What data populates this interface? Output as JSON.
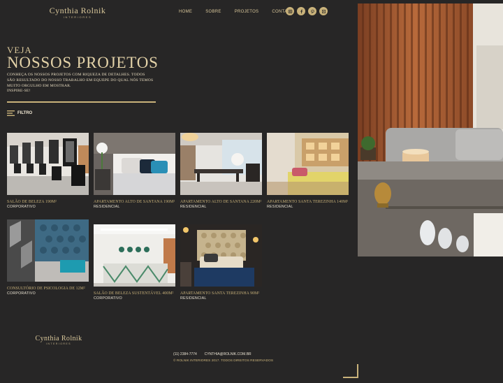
{
  "header": {
    "logo_name": "Cynthia Rolnik",
    "logo_sub": "INTERIORES",
    "nav": [
      "HOME",
      "SOBRE",
      "PROJETOS",
      "CONTATO"
    ],
    "social_icons": [
      "instagram-icon",
      "facebook-icon",
      "pinterest-icon",
      "houzz-icon"
    ]
  },
  "hero": {
    "kicker": "VEJA",
    "title": "NOSSOS PROJETOS",
    "description": "Conheça os nossos projetos com riqueza de detalhes. Todos são resultado do nosso trabalho em equepe do qual nós temos muito orgulho em mostrar.",
    "cta": "Inspire-se!",
    "filter_label": "FILTRO"
  },
  "projects": [
    {
      "title": "SALÃO DE BELEZA 190M²",
      "category": "CORPORATIVO"
    },
    {
      "title": "APARTAMENTO ALTO DE SANTANA 190M²",
      "category": "RESIDENCIAL"
    },
    {
      "title": "APARTAMENTO ALTO DE SANTANA 220M²",
      "category": "RESIDENCIAL"
    },
    {
      "title": "APARTAMENTO SANTA TEREZINHA 140M²",
      "category": "RESIDENCIAL"
    },
    {
      "title": "CONSULTÓRIO DE PSICOLOGIA DE 12M²",
      "category": "CORPORATIVO"
    },
    {
      "title": "SALÃO DE BELEZA SUSTENTÁVEL 400M²",
      "category": "CORPORATIVO"
    },
    {
      "title": "APARTAMENTO SANTA TEREZINHA 90M²",
      "category": "RESIDENCIAL"
    }
  ],
  "footer": {
    "logo_name": "Cynthia Rolnik",
    "logo_sub": "INTERIORES",
    "phone": "(11) 2384-7774",
    "email": "CYNTHIA@ROLNIK.COM.BR",
    "copyright": "© ROLNIK INTERIORES 2017. TODOS DIREITOS RESERVADOS"
  },
  "colors": {
    "background": "#272626",
    "accent": "#c9b27a",
    "text": "#e8dcc0"
  }
}
